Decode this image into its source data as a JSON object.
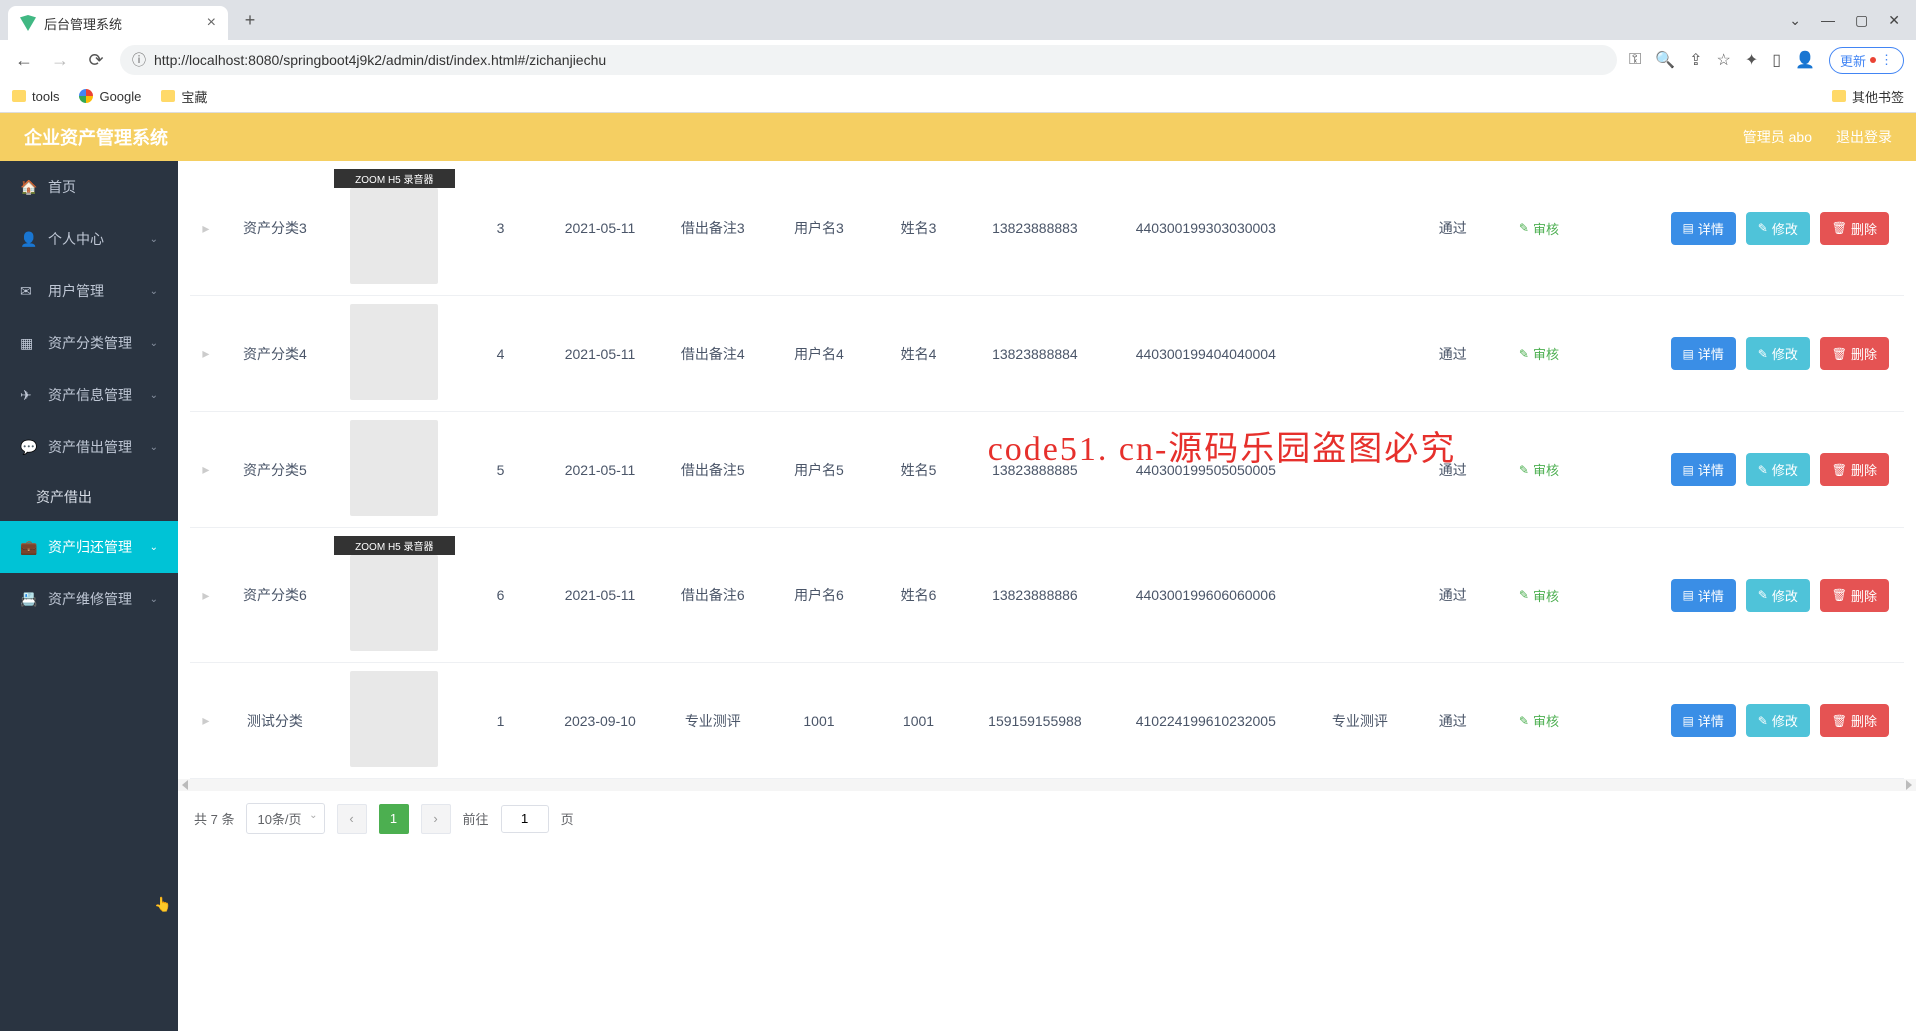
{
  "browser": {
    "tab_title": "后台管理系统",
    "url": "http://localhost:8080/springboot4j9k2/admin/dist/index.html#/zichanjiechu",
    "bookmarks": {
      "b1": "tools",
      "b2": "Google",
      "b3": "宝藏",
      "other": "其他书签"
    },
    "update_label": "更新"
  },
  "header": {
    "title": "企业资产管理系统",
    "admin_label": "管理员 abo",
    "logout_label": "退出登录"
  },
  "sidebar": {
    "home": "首页",
    "personal": "个人中心",
    "user_mgmt": "用户管理",
    "category_mgmt": "资产分类管理",
    "info_mgmt": "资产信息管理",
    "lend_mgmt": "资产借出管理",
    "lend_sub": "资产借出",
    "return_mgmt": "资产归还管理",
    "repair_mgmt": "资产维修管理"
  },
  "watermark_text": "code51. cn-源码乐园盗图必究",
  "actions": {
    "audit": "审核",
    "detail": "详情",
    "edit": "修改",
    "delete": "删除"
  },
  "rows": [
    {
      "cat": "资产分类3",
      "img_label": "ZOOM H5 录音器",
      "qty": "3",
      "date": "2021-05-11",
      "remark": "借出备注3",
      "user": "用户名3",
      "name": "姓名3",
      "phone": "13823888883",
      "idcard": "440300199303030003",
      "extra": "",
      "status": "通过"
    },
    {
      "cat": "资产分类4",
      "img_label": "",
      "qty": "4",
      "date": "2021-05-11",
      "remark": "借出备注4",
      "user": "用户名4",
      "name": "姓名4",
      "phone": "13823888884",
      "idcard": "440300199404040004",
      "extra": "",
      "status": "通过"
    },
    {
      "cat": "资产分类5",
      "img_label": "",
      "qty": "5",
      "date": "2021-05-11",
      "remark": "借出备注5",
      "user": "用户名5",
      "name": "姓名5",
      "phone": "13823888885",
      "idcard": "440300199505050005",
      "extra": "",
      "status": "通过"
    },
    {
      "cat": "资产分类6",
      "img_label": "ZOOM H5 录音器",
      "qty": "6",
      "date": "2021-05-11",
      "remark": "借出备注6",
      "user": "用户名6",
      "name": "姓名6",
      "phone": "13823888886",
      "idcard": "440300199606060006",
      "extra": "",
      "status": "通过"
    },
    {
      "cat": "测试分类",
      "img_label": "",
      "qty": "1",
      "date": "2023-09-10",
      "remark": "专业测评",
      "user": "1001",
      "name": "1001",
      "phone": "159159155988",
      "idcard": "410224199610232005",
      "extra": "专业测评",
      "status": "通过"
    }
  ],
  "pagination": {
    "total_label": "共 7 条",
    "per_page": "10条/页",
    "goto_prefix": "前往",
    "goto_suffix": "页",
    "current": "1",
    "input_value": "1"
  }
}
